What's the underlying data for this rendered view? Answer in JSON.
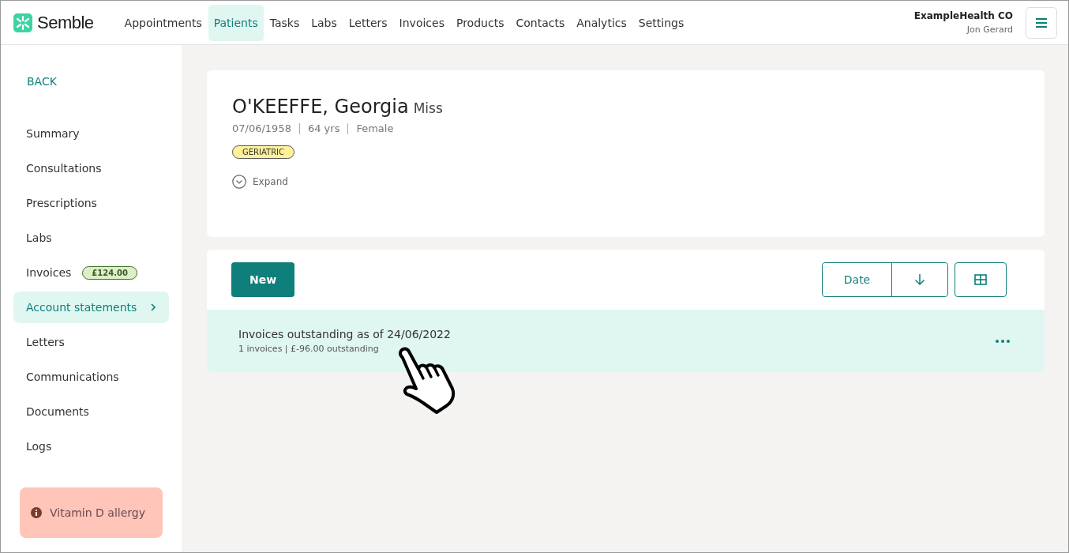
{
  "brand": {
    "name": "Semble"
  },
  "nav": [
    {
      "label": "Appointments",
      "selected": false
    },
    {
      "label": "Patients",
      "selected": true
    },
    {
      "label": "Tasks",
      "selected": false
    },
    {
      "label": "Labs",
      "selected": false
    },
    {
      "label": "Letters",
      "selected": false
    },
    {
      "label": "Invoices",
      "selected": false
    },
    {
      "label": "Products",
      "selected": false
    },
    {
      "label": "Contacts",
      "selected": false
    },
    {
      "label": "Analytics",
      "selected": false
    },
    {
      "label": "Settings",
      "selected": false
    }
  ],
  "account": {
    "organisation": "ExampleHealth CO",
    "user": "Jon Gerard"
  },
  "sidebar": {
    "back": "BACK",
    "items": [
      {
        "label": "Summary",
        "selected": false
      },
      {
        "label": "Consultations",
        "selected": false
      },
      {
        "label": "Prescriptions",
        "selected": false
      },
      {
        "label": "Labs",
        "selected": false
      },
      {
        "label": "Invoices",
        "selected": false,
        "badge": "£124.00"
      },
      {
        "label": "Account statements",
        "selected": true
      },
      {
        "label": "Letters",
        "selected": false
      },
      {
        "label": "Communications",
        "selected": false
      },
      {
        "label": "Documents",
        "selected": false
      },
      {
        "label": "Logs",
        "selected": false
      }
    ],
    "alert": "Vitamin D allergy"
  },
  "patient": {
    "name": "O'KEEFFE, Georgia",
    "title": "Miss",
    "details": [
      "07/06/1958",
      "64 yrs",
      "Female"
    ],
    "tags": [
      "GERIATRIC"
    ],
    "expand": "Expand"
  },
  "toolbar": {
    "new_button": "New",
    "sort_field": "Date"
  },
  "statements": [
    {
      "title": "Invoices outstanding as of 24/06/2022",
      "summary": "1 invoices | £-96.00 outstanding"
    }
  ]
}
